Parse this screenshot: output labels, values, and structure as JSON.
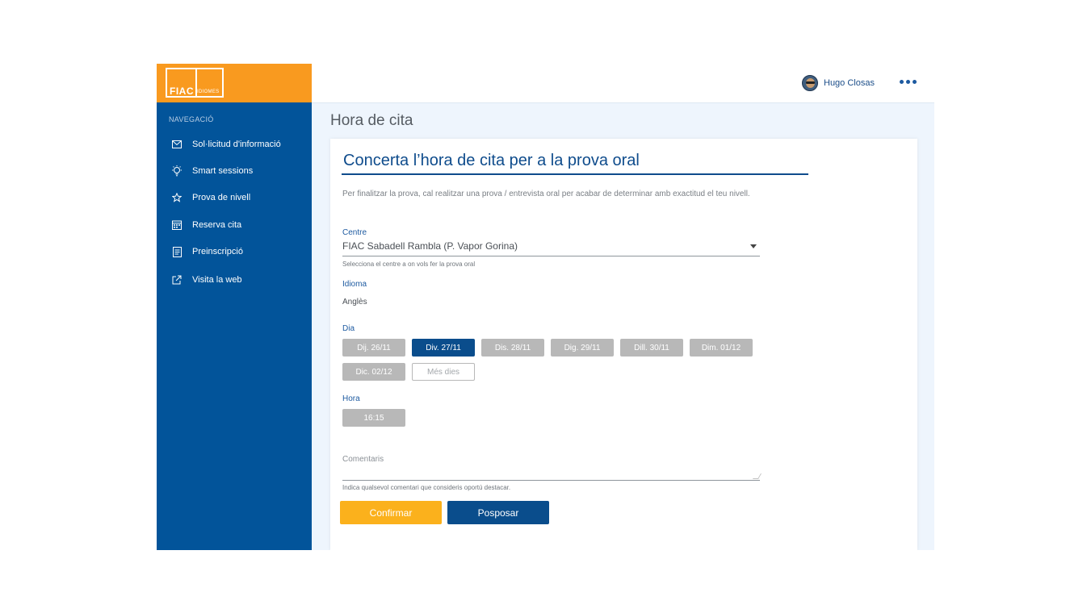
{
  "brand": {
    "logo_main": "FIAC",
    "logo_sub": "IDIOMES",
    "logo_bg": "#f99a1f"
  },
  "sidebar": {
    "heading": "NAVEGACIÓ",
    "items": [
      {
        "label": "Sol·licitud d'informació",
        "icon": "mail-icon"
      },
      {
        "label": "Smart sessions",
        "icon": "lightbulb-icon"
      },
      {
        "label": "Prova de nivell",
        "icon": "star-icon"
      },
      {
        "label": "Reserva cita",
        "icon": "calendar-icon"
      },
      {
        "label": "Preinscripció",
        "icon": "document-icon"
      },
      {
        "label": "Visita la web",
        "icon": "external-link-icon"
      }
    ]
  },
  "topbar": {
    "user_name": "Hugo Closas",
    "menu_icon": "more-dots-icon"
  },
  "page": {
    "title": "Hora de cita"
  },
  "form": {
    "title": "Concerta l’hora de cita per a la prova oral",
    "intro": "Per finalitzar la prova, cal realitzar una prova / entrevista oral per acabar de determinar amb exactitud el teu nivell.",
    "centre": {
      "label": "Centre",
      "value": "FIAC Sabadell Rambla (P. Vapor Gorina)",
      "hint": "Selecciona el centre a on vols fer la prova oral"
    },
    "idioma": {
      "label": "Idioma",
      "value": "Anglès"
    },
    "dia": {
      "label": "Dia",
      "options": [
        "Dij. 26/11",
        "Div. 27/11",
        "Dis. 28/11",
        "Dig. 29/11",
        "Dill. 30/11",
        "Dim. 01/12",
        "Dic. 02/12"
      ],
      "selected": "Div. 27/11",
      "more": "Més dies"
    },
    "hora": {
      "label": "Hora",
      "options": [
        "16:15"
      ]
    },
    "comentaris": {
      "placeholder": "Comentaris",
      "hint": "Indica qualsevol comentari que consideris oportú destacar."
    },
    "buttons": {
      "confirm": "Confirmar",
      "postpone": "Posposar"
    }
  },
  "colors": {
    "sidebar": "#02549a",
    "accent_orange": "#f99a1f",
    "confirm": "#fbb11c",
    "primary": "#0a4d8c",
    "chip": "#b8b8b8"
  }
}
